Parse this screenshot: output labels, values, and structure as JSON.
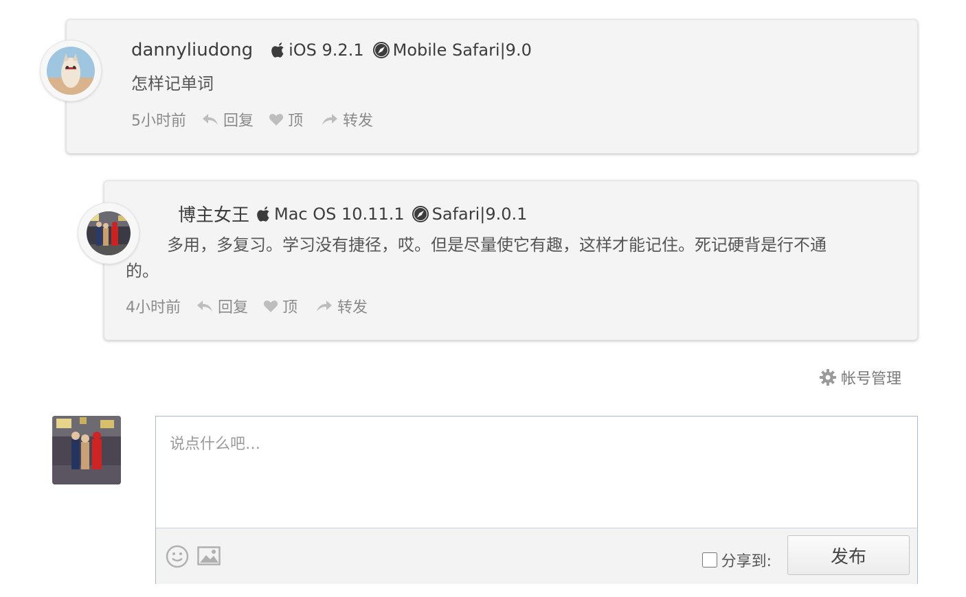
{
  "comments": [
    {
      "author": "dannyliudong",
      "os": "iOS 9.2.1",
      "browser": "Mobile Safari|9.0",
      "text": "怎样记单词",
      "time": "5小时前",
      "reply": "回复",
      "like": "顶",
      "share": "转发"
    },
    {
      "author": "博主女王",
      "os": "Mac OS 10.11.1",
      "browser": "Safari|9.0.1",
      "text_line1": "多用，多复习。学习没有捷径，哎。但是尽量使它有趣，这样才能记住。死记硬背是行不通",
      "text_line2": "的。",
      "time": "4小时前",
      "reply": "回复",
      "like": "顶",
      "share": "转发"
    }
  ],
  "account": {
    "label": "帐号管理"
  },
  "composer": {
    "placeholder": "说点什么吧…",
    "share_label": "分享到:",
    "publish_label": "发布"
  },
  "icons": {
    "os_icon": "apple-icon",
    "browser_icon": "compass-icon",
    "reply_icon": "reply-arrow-icon",
    "like_icon": "heart-icon",
    "share_icon": "forward-arrow-icon",
    "account_icon": "gear-icon",
    "emoji_icon": "smiley-icon",
    "image_icon": "image-icon"
  }
}
